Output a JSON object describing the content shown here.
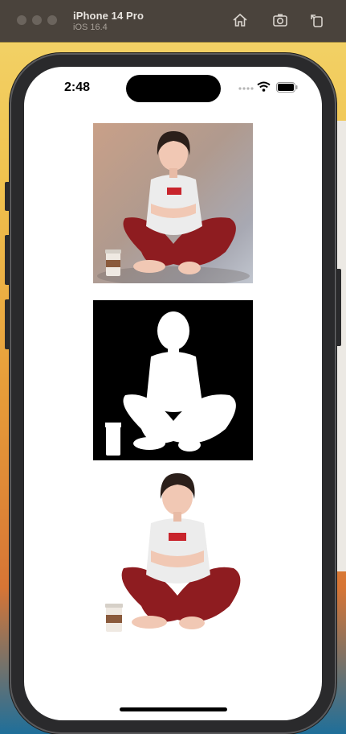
{
  "simulator": {
    "device_name": "iPhone 14 Pro",
    "os_version": "iOS 16.4",
    "toolbar_icons": [
      "home-icon",
      "screenshot-icon",
      "rotate-icon"
    ]
  },
  "status_bar": {
    "time": "2:48",
    "icons": [
      "signal-dots-icon",
      "wifi-icon",
      "battery-icon"
    ]
  },
  "content": {
    "images": [
      {
        "role": "original-photo"
      },
      {
        "role": "segmentation-mask"
      },
      {
        "role": "cutout-result"
      }
    ]
  },
  "colors": {
    "shirt_logo": "#c8242c",
    "pants": "#8e1c20",
    "hair": "#2b1f1a",
    "skin": "#f1c8b4"
  }
}
